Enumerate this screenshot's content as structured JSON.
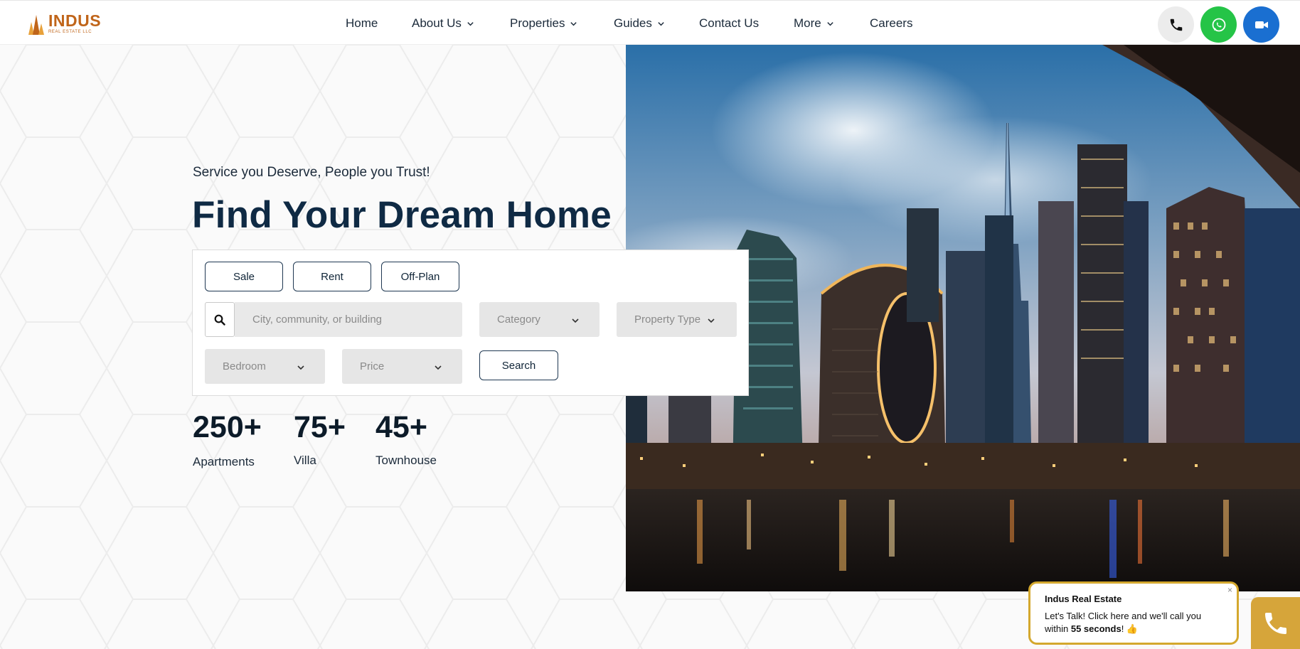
{
  "brand": {
    "name": "INDUS",
    "tagline": "REAL ESTATE LLC",
    "accent": "#c0651a"
  },
  "nav": {
    "items": [
      {
        "label": "Home",
        "dropdown": false
      },
      {
        "label": "About Us",
        "dropdown": true
      },
      {
        "label": "Properties",
        "dropdown": true
      },
      {
        "label": "Guides",
        "dropdown": true
      },
      {
        "label": "Contact Us",
        "dropdown": false
      },
      {
        "label": "More",
        "dropdown": true
      },
      {
        "label": "Careers",
        "dropdown": false
      }
    ],
    "actions": [
      {
        "icon": "phone-icon",
        "color": "#ececec"
      },
      {
        "icon": "whatsapp-icon",
        "color": "#25c447"
      },
      {
        "icon": "video-call-icon",
        "color": "#1a6fd1"
      }
    ]
  },
  "hero": {
    "tagline": "Service you Deserve, People you Trust!",
    "headline": "Find Your Dream Home"
  },
  "search": {
    "tabs": [
      "Sale",
      "Rent",
      "Off-Plan"
    ],
    "location_placeholder": "City, community, or building",
    "category": "Category",
    "property_type": "Property Type",
    "bedroom": "Bedroom",
    "price": "Price",
    "submit": "Search"
  },
  "stats": [
    {
      "value": "250+",
      "label": "Apartments"
    },
    {
      "value": "75+",
      "label": "Villa"
    },
    {
      "value": "45+",
      "label": "Townhouse"
    }
  ],
  "chat": {
    "title": "Indus Real Estate",
    "message_prefix": "Let's Talk! Click here and we'll call you within ",
    "message_bold": "55 seconds",
    "message_suffix": "! 👍",
    "close": "×"
  },
  "colors": {
    "primary": "#0f2a44",
    "gold": "#d4a82e"
  }
}
